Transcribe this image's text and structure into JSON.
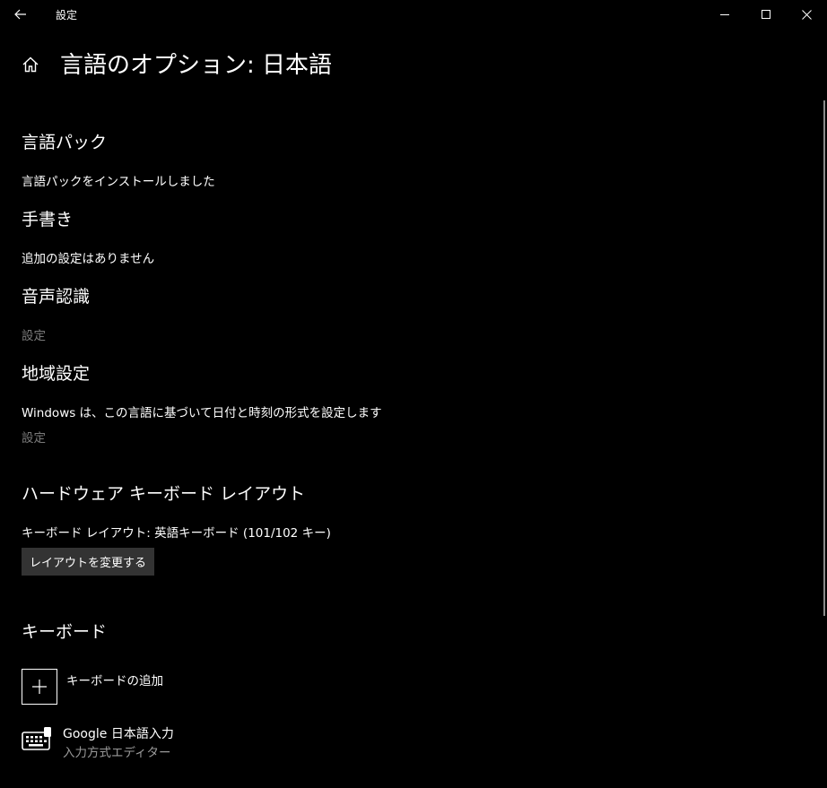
{
  "window": {
    "app_title": "設定"
  },
  "header": {
    "page_title": "言語のオプション: 日本語"
  },
  "sections": {
    "language_pack": {
      "heading": "言語パック",
      "status": "言語パックをインストールしました"
    },
    "handwriting": {
      "heading": "手書き",
      "status": "追加の設定はありません"
    },
    "speech": {
      "heading": "音声認識",
      "settings_link": "設定"
    },
    "regional": {
      "heading": "地域設定",
      "description": "Windows は、この言語に基づいて日付と時刻の形式を設定します",
      "settings_link": "設定"
    },
    "hardware_keyboard": {
      "heading": "ハードウェア キーボード レイアウト",
      "layout_text": "キーボード レイアウト: 英語キーボード (101/102 キー)",
      "change_button": "レイアウトを変更する"
    },
    "keyboards": {
      "heading": "キーボード",
      "add_label": "キーボードの追加",
      "items": [
        {
          "name": "Google 日本語入力",
          "subtitle": "入力方式エディター"
        }
      ]
    }
  },
  "icons": {
    "back": "back-arrow-icon",
    "home": "home-icon",
    "add": "plus-icon",
    "keyboard": "keyboard-icon",
    "minimize": "minimize-icon",
    "maximize": "maximize-icon",
    "close": "close-icon"
  },
  "colors": {
    "background": "#000000",
    "text": "#ffffff",
    "muted": "#7a7a7a",
    "button_bg": "#333333"
  }
}
